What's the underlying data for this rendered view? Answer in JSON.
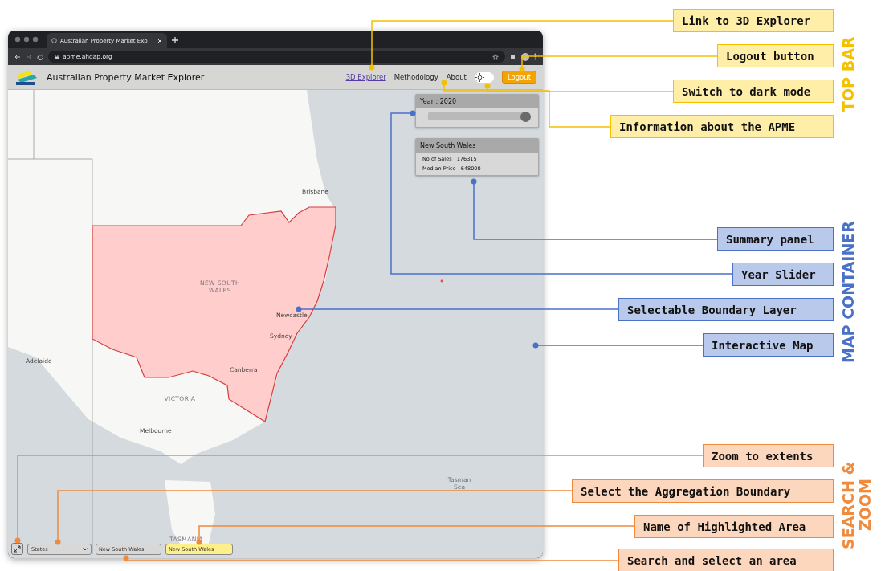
{
  "browser": {
    "tab_title": "Australian Property Market Exp",
    "url": "apme.ahdap.org"
  },
  "app": {
    "title": "Australian Property Market Explorer",
    "nav": [
      {
        "label": "3D Explorer",
        "kind": "link"
      },
      {
        "label": "Methodology",
        "kind": "plain"
      },
      {
        "label": "About",
        "kind": "plain"
      }
    ],
    "dark_mode": {
      "on": false
    },
    "logout": "Logout"
  },
  "year_panel": {
    "label": "Year : 2020",
    "level": 0.96
  },
  "summary_panel": {
    "title": "New South Wales",
    "rows": [
      {
        "label": "No of Sales",
        "value": "176315"
      },
      {
        "label": "Median Price",
        "value": "648000"
      }
    ]
  },
  "map_labels": [
    {
      "text": "Brisbane",
      "kind": "city"
    },
    {
      "text": "NEW SOUTH WALES",
      "kind": "region"
    },
    {
      "text": "Newcastle",
      "kind": "city"
    },
    {
      "text": "Sydney",
      "kind": "city"
    },
    {
      "text": "Canberra",
      "kind": "city"
    },
    {
      "text": "Adelaide",
      "kind": "city"
    },
    {
      "text": "VICTORIA",
      "kind": "region"
    },
    {
      "text": "Melbourne",
      "kind": "city"
    },
    {
      "text": "TASMANIA",
      "kind": "region"
    },
    {
      "text": "Tasman Sea",
      "kind": "sea"
    }
  ],
  "controls": {
    "aggregation": "States",
    "search": "New South Wales",
    "highlighted": "New South Wales"
  },
  "sections": [
    {
      "title": "TOP BAR",
      "color": "#f5c000",
      "callouts": [
        "Link to 3D Explorer",
        "Logout button",
        "Switch to dark mode",
        "Information about the APME"
      ]
    },
    {
      "title": "MAP CONTAINER",
      "color": "#4a70c8",
      "callouts": [
        "Summary panel",
        "Year Slider",
        "Selectable Boundary Layer",
        "Interactive Map"
      ]
    },
    {
      "title": "SEARCH & ZOOM",
      "color": "#f08a3c",
      "callouts": [
        "Zoom to extents",
        "Select the Aggregation Boundary",
        "Name of Highlighted Area",
        "Search and select an area"
      ]
    }
  ]
}
